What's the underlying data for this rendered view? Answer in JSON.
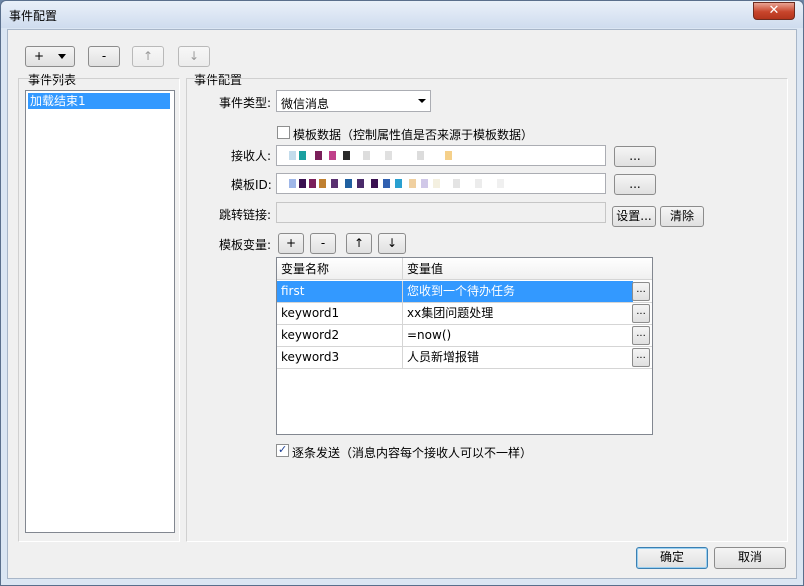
{
  "window": {
    "title": "事件配置",
    "close_icon": "close-x-icon"
  },
  "toolbar": {
    "add_label": "+",
    "remove_label": "-",
    "up_label": "↑",
    "down_label": "↓"
  },
  "event_list": {
    "header": "事件列表",
    "items": [
      "加载结束1"
    ],
    "selected_index": 0
  },
  "event_config": {
    "header": "事件配置",
    "event_type_label": "事件类型:",
    "event_type_value": "微信消息",
    "template_data_label": "模板数据（控制属性值是否来源于模板数据）",
    "template_data_checked": false,
    "recipient_label": "接收人:",
    "template_id_label": "模板ID:",
    "browse_label": "...",
    "jump_link_label": "跳转链接:",
    "settings_label": "设置...",
    "clear_label": "清除",
    "template_vars_label": "模板变量:",
    "vars_add": "+",
    "vars_remove": "-",
    "vars_up": "↑",
    "vars_down": "↓",
    "grid": {
      "col_name": "变量名称",
      "col_value": "变量值",
      "rows": [
        {
          "name": "first",
          "value": "您收到一个待办任务",
          "selected": true
        },
        {
          "name": "keyword1",
          "value": "xx集团问题处理",
          "selected": false
        },
        {
          "name": "keyword2",
          "value": "=now()",
          "selected": false
        },
        {
          "name": "keyword3",
          "value": "人员新增报错",
          "selected": false
        }
      ],
      "cell_button": "..."
    },
    "send_one_by_one_label": "逐条发送（消息内容每个接收人可以不一样）",
    "send_one_by_one_checked": true
  },
  "footer": {
    "ok_label": "确定",
    "cancel_label": "取消"
  },
  "colors": {
    "selection": "#3399ff",
    "title_bar": "#cfdcee",
    "close_button": "#c8452c"
  }
}
